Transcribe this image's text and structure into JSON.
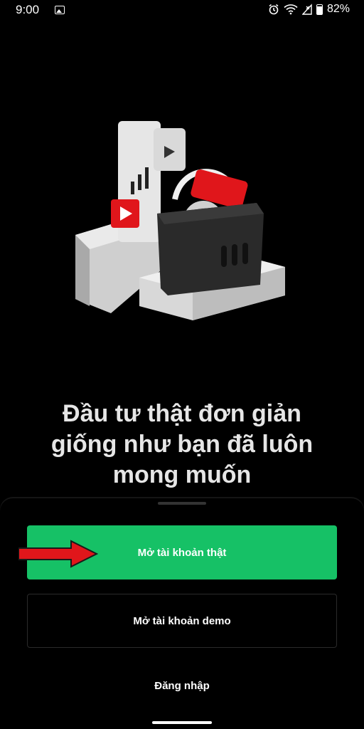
{
  "status_bar": {
    "time": "9:00",
    "battery": "82%"
  },
  "headline": "Đầu tư thật đơn giản giống như bạn đã luôn mong muốn",
  "buttons": {
    "open_real": "Mở tài khoản thật",
    "open_demo": "Mở tài khoản demo",
    "login": "Đăng nhập"
  },
  "colors": {
    "accent": "#16c166",
    "annotation_arrow": "#e0161b",
    "background": "#000000"
  },
  "icons": [
    "image-icon",
    "alarm-icon",
    "wifi-icon",
    "signal-icon",
    "battery-icon",
    "play-icon"
  ]
}
